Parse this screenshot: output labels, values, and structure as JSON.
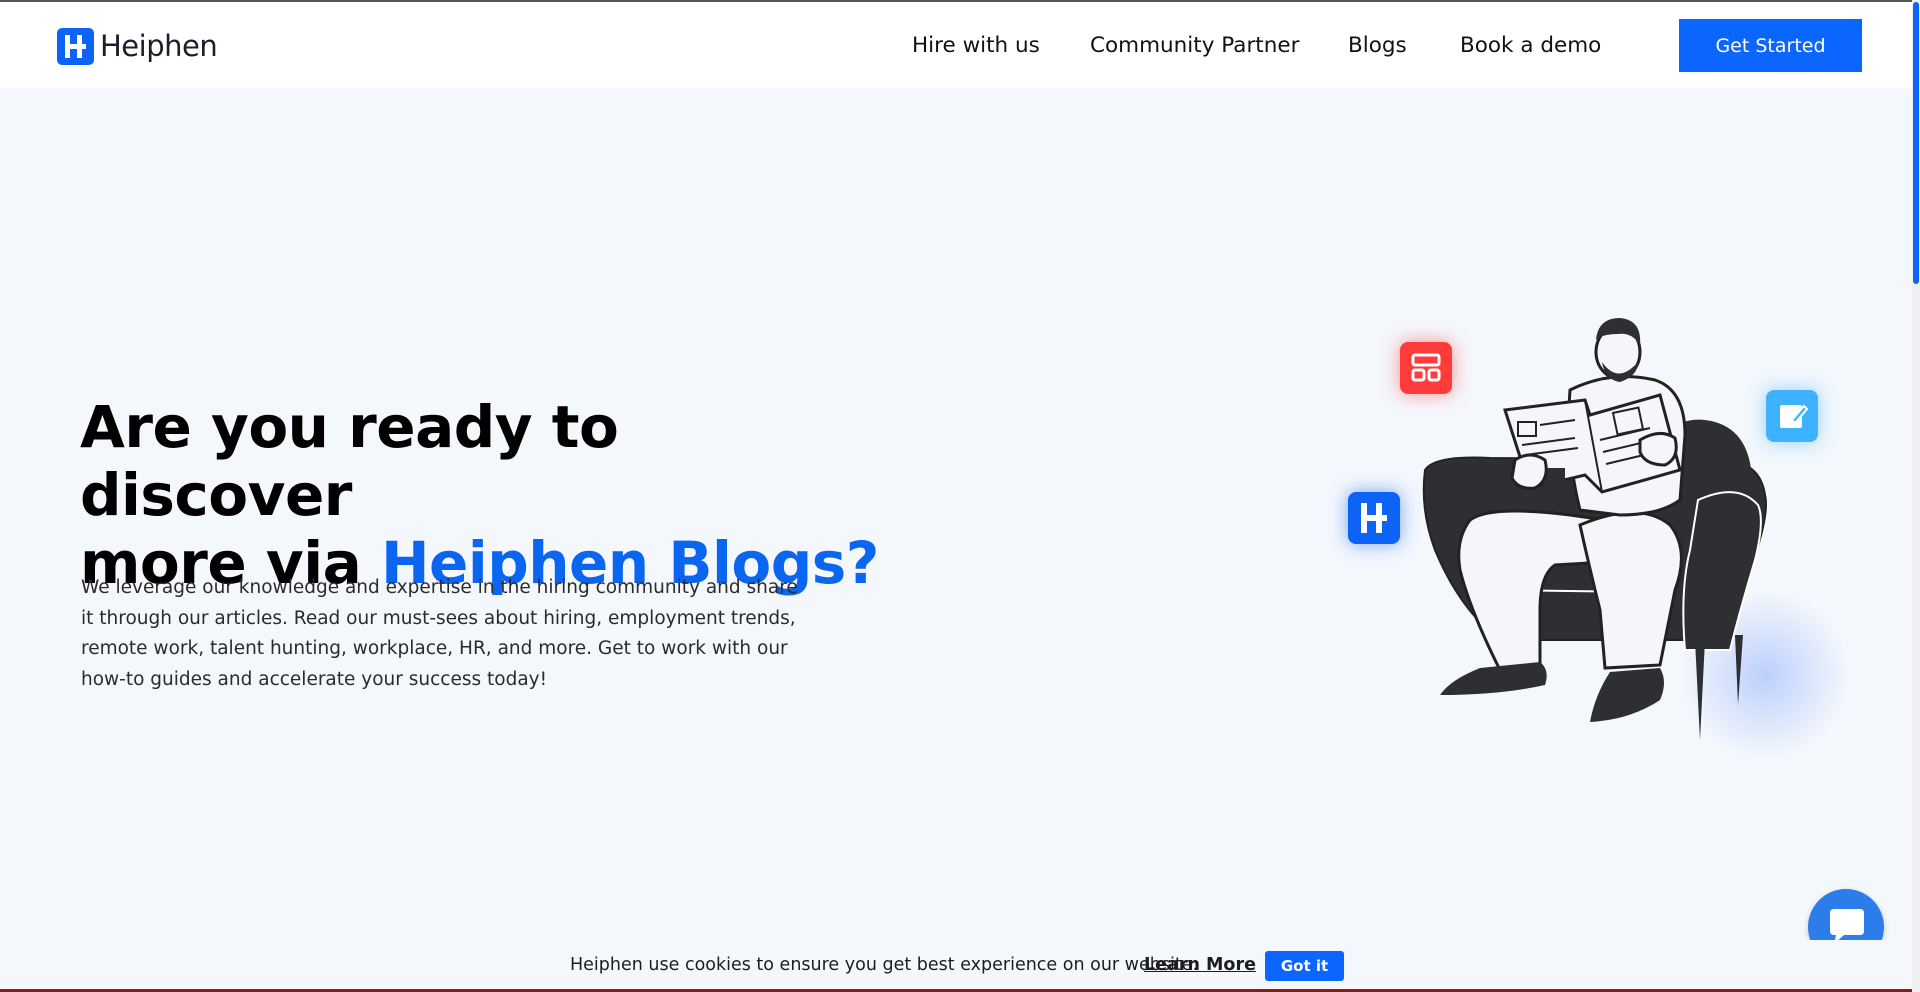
{
  "brand": {
    "name": "Heiphen",
    "color": "#0d63f5"
  },
  "nav": {
    "items": [
      "Hire with us",
      "Community Partner",
      "Blogs",
      "Book a demo"
    ],
    "cta": "Get Started"
  },
  "hero": {
    "title_line1": "Are you ready to discover",
    "title_line2_prefix": "more via ",
    "title_accent": "Heiphen Blogs?",
    "description": "We leverage our knowledge and expertise in the hiring community and share it through our articles. Read our must-sees about hiring, employment trends, remote work, talent hunting, workplace, HR, and more. Get to work with our how-to guides and accelerate your success today!"
  },
  "cookie": {
    "text": "Heiphen use cookies to ensure you get best experience on our website.",
    "link": "Learn More",
    "button": "Got it"
  },
  "icons": {
    "chat": "chat-bubble-icon",
    "red_chip": "layout-icon",
    "cyan_chip": "edit-note-icon",
    "blue_chip": "heiphen-logo-icon"
  },
  "colors": {
    "accent": "#0a66ff",
    "background": "#f4f7fc"
  }
}
